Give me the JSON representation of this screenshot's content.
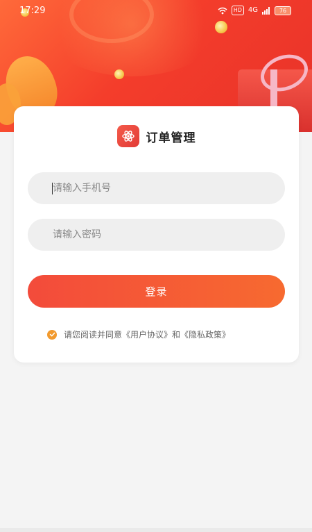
{
  "status_bar": {
    "time": "17:29",
    "hd_label": "HD",
    "network_label": "4G",
    "battery_label": "76"
  },
  "app": {
    "title": "订单管理"
  },
  "form": {
    "phone_placeholder": "请输入手机号",
    "password_placeholder": "请输入密码",
    "login_label": "登录",
    "agreement_text": "请您阅读并同意《用户协议》和《隐私政策》"
  },
  "colors": {
    "primary_start": "#f34b3b",
    "primary_end": "#f76a30",
    "check_color": "#f29a2e"
  }
}
